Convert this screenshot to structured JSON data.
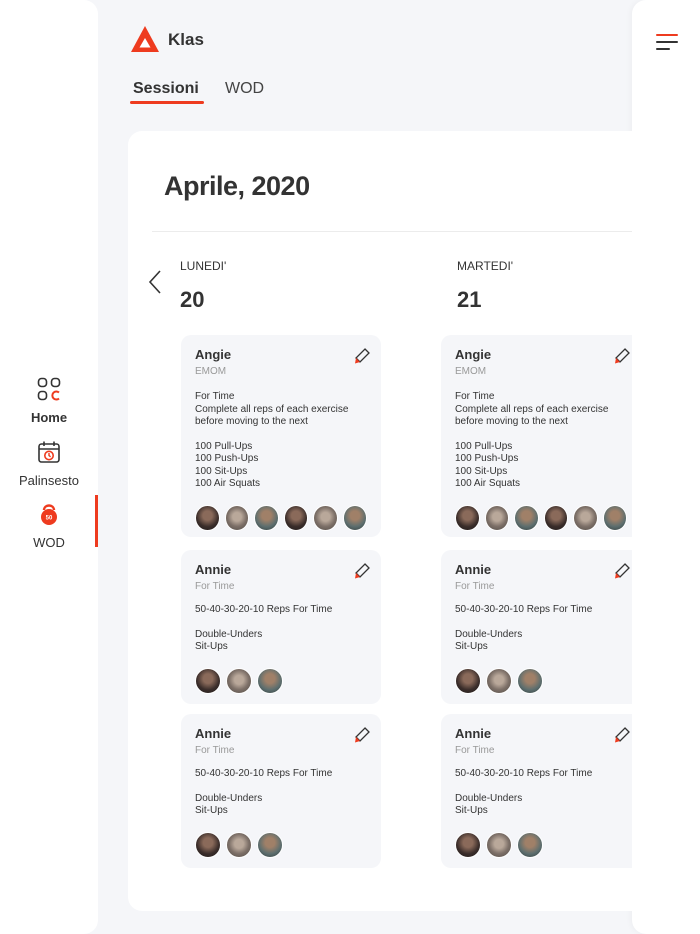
{
  "brand": {
    "name": "Klas"
  },
  "tabs": [
    {
      "label": "Sessioni",
      "active": true
    },
    {
      "label": "WOD",
      "active": false
    }
  ],
  "sidebar": {
    "items": [
      {
        "label": "Home",
        "icon": "home-grid-icon"
      },
      {
        "label": "Palinsesto",
        "icon": "calendar-icon"
      },
      {
        "label": "WOD",
        "icon": "kettlebell-icon",
        "active": true
      }
    ]
  },
  "calendar": {
    "month": "Aprile, 2020",
    "days": [
      {
        "name": "LUNEDI'",
        "number": "20",
        "wods": [
          {
            "title": "Angie",
            "subtitle": "EMOM",
            "description": "For Time\nComplete all reps of each exercise\nbefore moving to the next",
            "exercises": "100 Pull-Ups\n100 Push-Ups\n100 Sit-Ups\n100 Air Squats",
            "avatars": 6
          },
          {
            "title": "Annie",
            "subtitle": "For Time",
            "description": "50-40-30-20-10 Reps For Time",
            "exercises": "Double-Unders\nSit-Ups",
            "avatars": 3
          },
          {
            "title": "Annie",
            "subtitle": "For Time",
            "description": "50-40-30-20-10 Reps For Time",
            "exercises": "Double-Unders\nSit-Ups",
            "avatars": 3
          }
        ]
      },
      {
        "name": "MARTEDI'",
        "number": "21",
        "wods": [
          {
            "title": "Angie",
            "subtitle": "EMOM",
            "description": "For Time\nComplete all reps of each exercise\nbefore moving to the next",
            "exercises": "100 Pull-Ups\n100 Push-Ups\n100 Sit-Ups\n100 Air Squats",
            "avatars": 6
          },
          {
            "title": "Annie",
            "subtitle": "For Time",
            "description": "50-40-30-20-10 Reps For Time",
            "exercises": "Double-Unders\nSit-Ups",
            "avatars": 3
          },
          {
            "title": "Annie",
            "subtitle": "For Time",
            "description": "50-40-30-20-10 Reps For Time",
            "exercises": "Double-Unders\nSit-Ups",
            "avatars": 3
          }
        ]
      }
    ]
  },
  "colors": {
    "accent": "#ee3b1f",
    "text": "#333333",
    "muted": "#999999",
    "background": "#f5f6f9"
  }
}
